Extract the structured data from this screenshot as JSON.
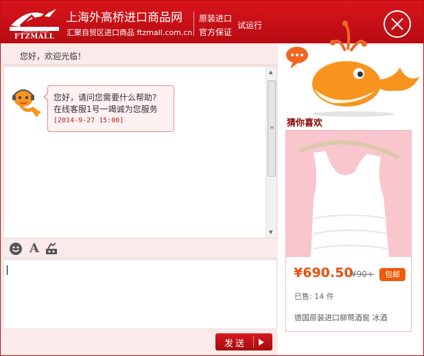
{
  "header": {
    "logo_text": "FTZMALL",
    "logo_subtext": "上海外高桥进口商品网",
    "site_name": "上海外高桥进口商品网",
    "site_subtitle": "汇聚自贸区进口商品 ftzmall.com.cn",
    "tag_line1": "原装进口",
    "tag_line2": "官方保证",
    "trial_label": "试运行",
    "close_icon": "close-icon"
  },
  "chat": {
    "greeting": "您好，欢迎光临！",
    "message_line1": "您好，请问您需要什么帮助?",
    "message_line2": "在线客服1号一竭诚为您服务",
    "message_time": "[2014-9-27 15:00]",
    "send_label": "发送",
    "toolbar_icons": [
      "emoji-icon",
      "font-icon",
      "screenshot-icon"
    ]
  },
  "recommend": {
    "title": "猜你喜欢",
    "price": "¥690.50",
    "old_price": "¥90+",
    "badge": "包邮",
    "sold": "已售: 14 件",
    "product_name": "德国原装进口柳莺酒窖 冰酒"
  },
  "colors": {
    "brand_red": "#c4111a",
    "price_orange": "#e8500f",
    "badge_orange": "#f05a0a"
  }
}
